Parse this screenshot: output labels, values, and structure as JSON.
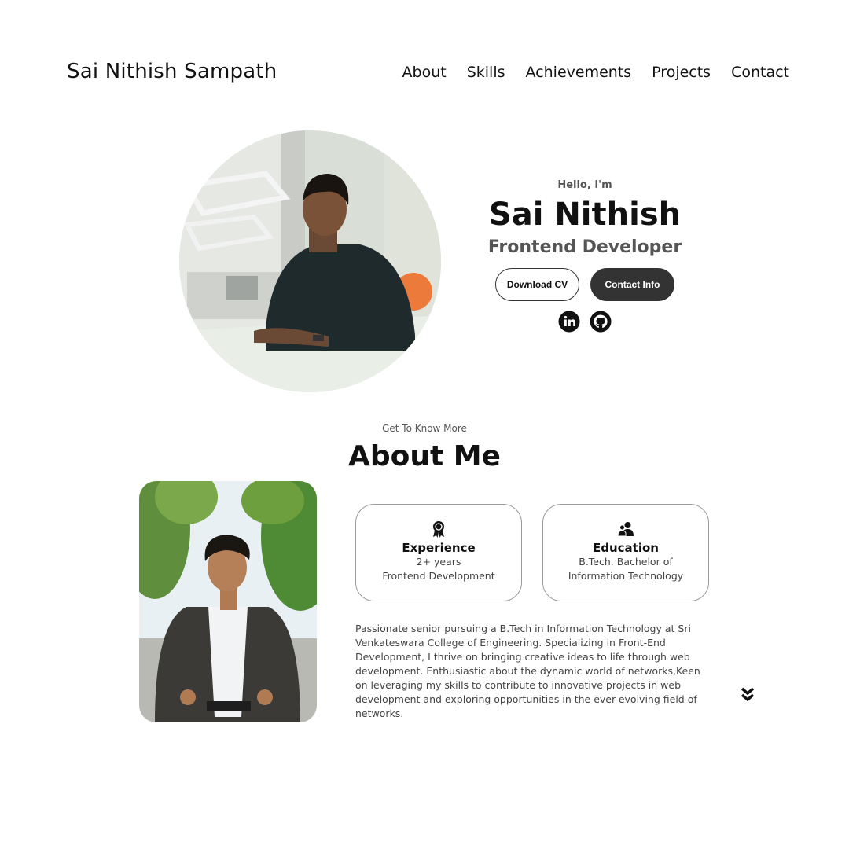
{
  "nav": {
    "logo": "Sai Nithish Sampath",
    "links": [
      "About",
      "Skills",
      "Achievements",
      "Projects",
      "Contact"
    ]
  },
  "hero": {
    "greeting": "Hello, I'm",
    "name": "Sai Nithish",
    "role": "Frontend Developer",
    "download_cv_label": "Download CV",
    "contact_info_label": "Contact Info",
    "socials": [
      "linkedin-icon",
      "github-icon"
    ]
  },
  "about": {
    "subtitle": "Get To Know More",
    "title": "About Me",
    "cards": [
      {
        "icon": "award-icon",
        "title": "Experience",
        "lines": [
          "2+ years",
          "Frontend Development"
        ]
      },
      {
        "icon": "users-icon",
        "title": "Education",
        "lines": [
          "B.Tech. Bachelor of",
          "Information Technology"
        ]
      }
    ],
    "description": "Passionate senior pursuing a B.Tech in Information Technology at Sri Venkateswara College of Engineering. Specializing in Front-End Development, I thrive on bringing creative ideas to life through web development. Enthusiastic about the dynamic world of networks,Keen on leveraging my skills to contribute to innovative projects in web development and exploring opportunities in the ever-evolving field of networks."
  },
  "colors": {
    "accent_dark": "#333333",
    "text": "#111111",
    "muted": "#555555"
  }
}
